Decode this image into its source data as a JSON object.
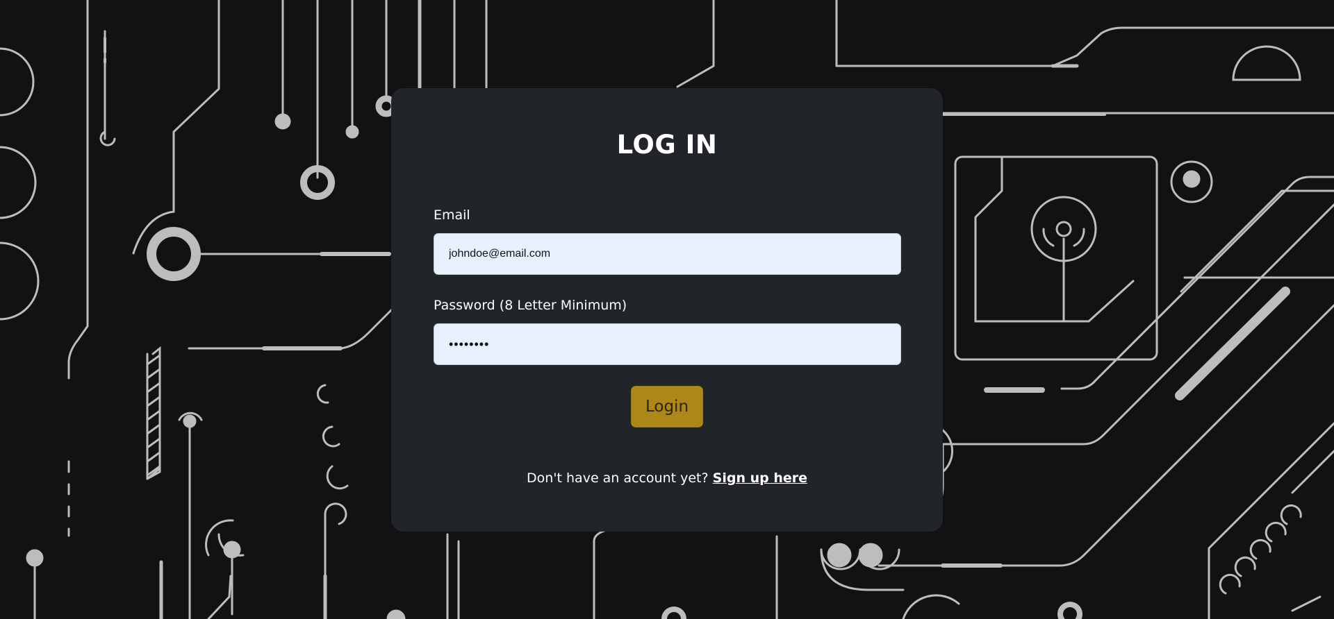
{
  "login": {
    "title": "LOG IN",
    "email_label": "Email",
    "email_value": "johndoe@email.com",
    "password_label": "Password (8 Letter Minimum)",
    "password_value": "••••••••",
    "login_button": "Login",
    "signup_prompt": "Don't have an account yet?",
    "signup_link": "Sign up here"
  },
  "colors": {
    "page_background": "#121212",
    "card_background": "#212428",
    "input_background": "#e8f0fe",
    "button_accent": "#ad8717",
    "circuit_lines": "#bdbdbd"
  }
}
